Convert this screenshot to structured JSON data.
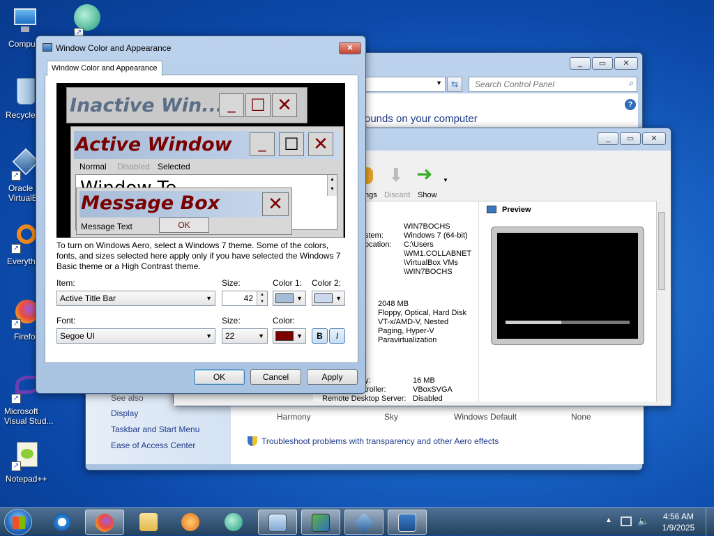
{
  "desktop": {
    "icons": [
      {
        "label": "Compu",
        "icon": "computer-icon"
      },
      {
        "label": "Recycle",
        "icon": "recycle-bin-icon"
      },
      {
        "label": "Oracle\nVirtualB",
        "icon": "virtualbox-icon"
      },
      {
        "label": "Everyth",
        "icon": "everything-search-icon"
      },
      {
        "label": "Firefo",
        "icon": "firefox-icon"
      },
      {
        "label": "Microsoft\nVisual Stud...",
        "icon": "visual-studio-icon"
      },
      {
        "label": "Notepad++",
        "icon": "notepad-plus-plus-icon"
      }
    ]
  },
  "control_panel": {
    "search_placeholder": "Search Control Panel",
    "heading_fragment": "ounds on your computer",
    "see_also": "See also",
    "links": [
      "Display",
      "Taskbar and Start Menu",
      "Ease of Access Center"
    ],
    "themes": [
      "Harmony",
      "Sky",
      "Windows Default",
      "None"
    ],
    "troubleshoot": "Troubleshoot problems with transparency and other Aero effects"
  },
  "vbox": {
    "toolbar": [
      "ngs",
      "Discard",
      "Show"
    ],
    "preview_title": "Preview",
    "general": [
      "WIN7BOCHS",
      "Windows 7 (64-bit)",
      "C:\\Users",
      "\\WM1.COLLABNET",
      "\\VirtualBox VMs",
      "\\WIN7BOCHS"
    ],
    "general_labels": [
      "stem:",
      "ocation:"
    ],
    "system": [
      "2048 MB",
      "Floppy, Optical, Hard Disk",
      "VT-x/AMD-V, Nested",
      "Paging, Hyper-V",
      "Paravirtualization"
    ],
    "display_labels": [
      "y:",
      "troller:",
      "Remote Desktop Server:"
    ],
    "display_values": [
      "16 MB",
      "VBoxSVGA",
      "Disabled"
    ]
  },
  "dialog": {
    "title": "Window Color and Appearance",
    "tab": "Window Color and Appearance",
    "preview": {
      "inactive": "Inactive Win...",
      "active": "Active Window",
      "menu": [
        "Normal",
        "Disabled",
        "Selected"
      ],
      "window_text": "Window Te",
      "message_box": "Message Box",
      "message_text": "Message Text",
      "ok": "OK"
    },
    "description": "To turn on Windows Aero, select a Windows 7 theme.  Some of the colors, fonts, and sizes selected here apply only if you have selected the Windows 7 Basic theme or a High Contrast theme.",
    "item_label": "Item:",
    "item_value": "Active Title Bar",
    "size_label": "Size:",
    "size_value": "42",
    "color1_label": "Color 1:",
    "color2_label": "Color 2:",
    "font_label": "Font:",
    "font_value": "Segoe UI",
    "font_size_label": "Size:",
    "font_size_value": "22",
    "color_label": "Color:",
    "bold": "B",
    "italic": "I",
    "buttons": {
      "ok": "OK",
      "cancel": "Cancel",
      "apply": "Apply"
    },
    "colors": {
      "color1": "#a7bcd8",
      "color2": "#c9d9ee",
      "font_color": "#7b0000"
    }
  },
  "taskbar": {
    "time": "4:56 AM",
    "date": "1/9/2025"
  }
}
